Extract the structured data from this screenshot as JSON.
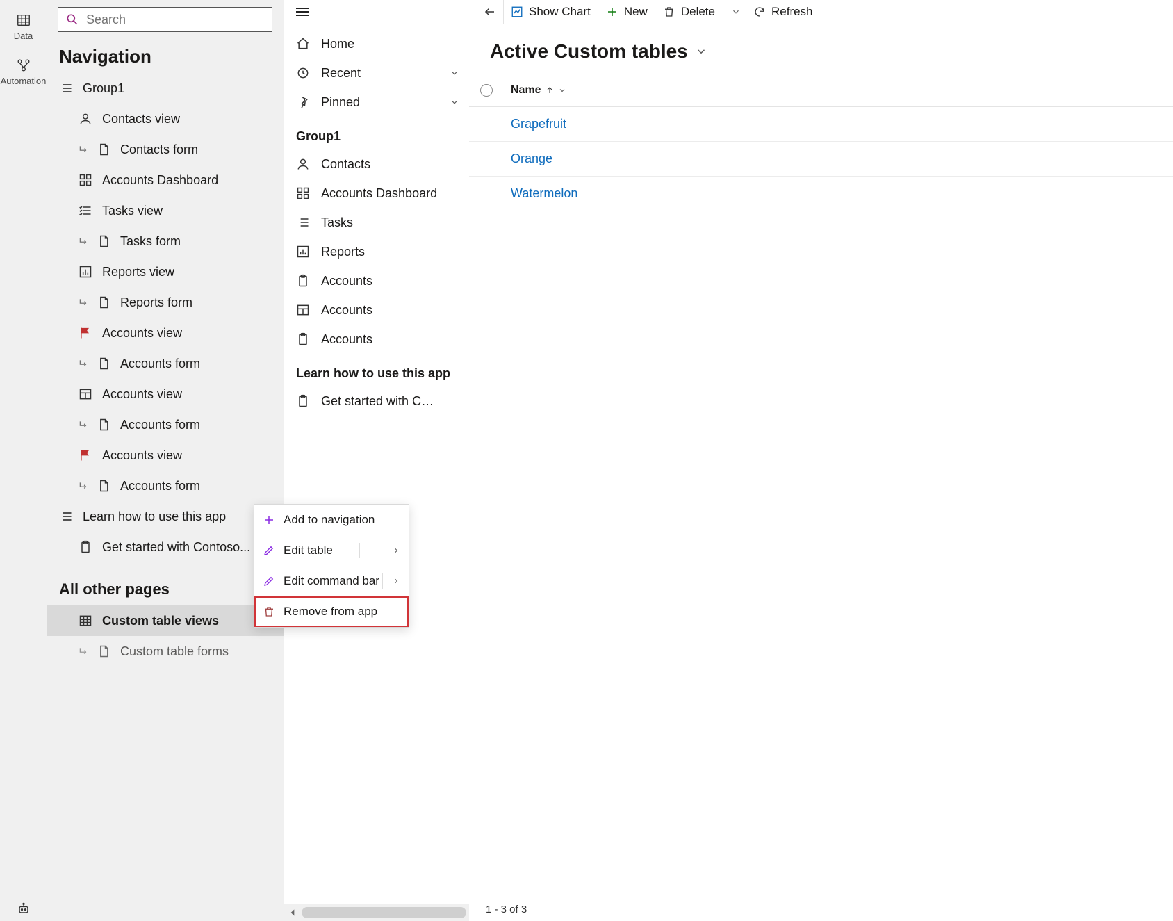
{
  "rail": {
    "data": "Data",
    "automation": "Automation"
  },
  "search": {
    "placeholder": "Search"
  },
  "nav": {
    "title": "Navigation",
    "group1": "Group1",
    "items": {
      "contacts_view": "Contacts view",
      "contacts_form": "Contacts form",
      "accounts_dashboard": "Accounts Dashboard",
      "tasks_view": "Tasks view",
      "tasks_form": "Tasks form",
      "reports_view": "Reports view",
      "reports_form": "Reports form",
      "accounts_view1": "Accounts view",
      "accounts_form1": "Accounts form",
      "accounts_view2": "Accounts view",
      "accounts_form2": "Accounts form",
      "accounts_view3": "Accounts view",
      "accounts_form3": "Accounts form"
    },
    "learn_group": "Learn how to use this app",
    "get_started": "Get started with Contoso...",
    "all_other": "All other pages",
    "custom_views": "Custom table views",
    "custom_forms": "Custom table forms"
  },
  "mid": {
    "home": "Home",
    "recent": "Recent",
    "pinned": "Pinned",
    "group1": "Group1",
    "contacts": "Contacts",
    "accounts_dashboard": "Accounts Dashboard",
    "tasks": "Tasks",
    "reports": "Reports",
    "accounts1": "Accounts",
    "accounts2": "Accounts",
    "accounts3": "Accounts",
    "learn": "Learn how to use this app",
    "get_started": "Get started with Con..."
  },
  "cmd": {
    "show_chart": "Show Chart",
    "new": "New",
    "delete": "Delete",
    "refresh": "Refresh"
  },
  "view": {
    "title": "Active Custom tables"
  },
  "grid": {
    "col_name": "Name",
    "rows": {
      "r0": "Grapefruit",
      "r1": "Orange",
      "r2": "Watermelon"
    },
    "footer": "1 - 3 of 3"
  },
  "ctx": {
    "add": "Add to navigation",
    "edit_table": "Edit table",
    "edit_cmdbar": "Edit command bar",
    "remove": "Remove from app"
  }
}
